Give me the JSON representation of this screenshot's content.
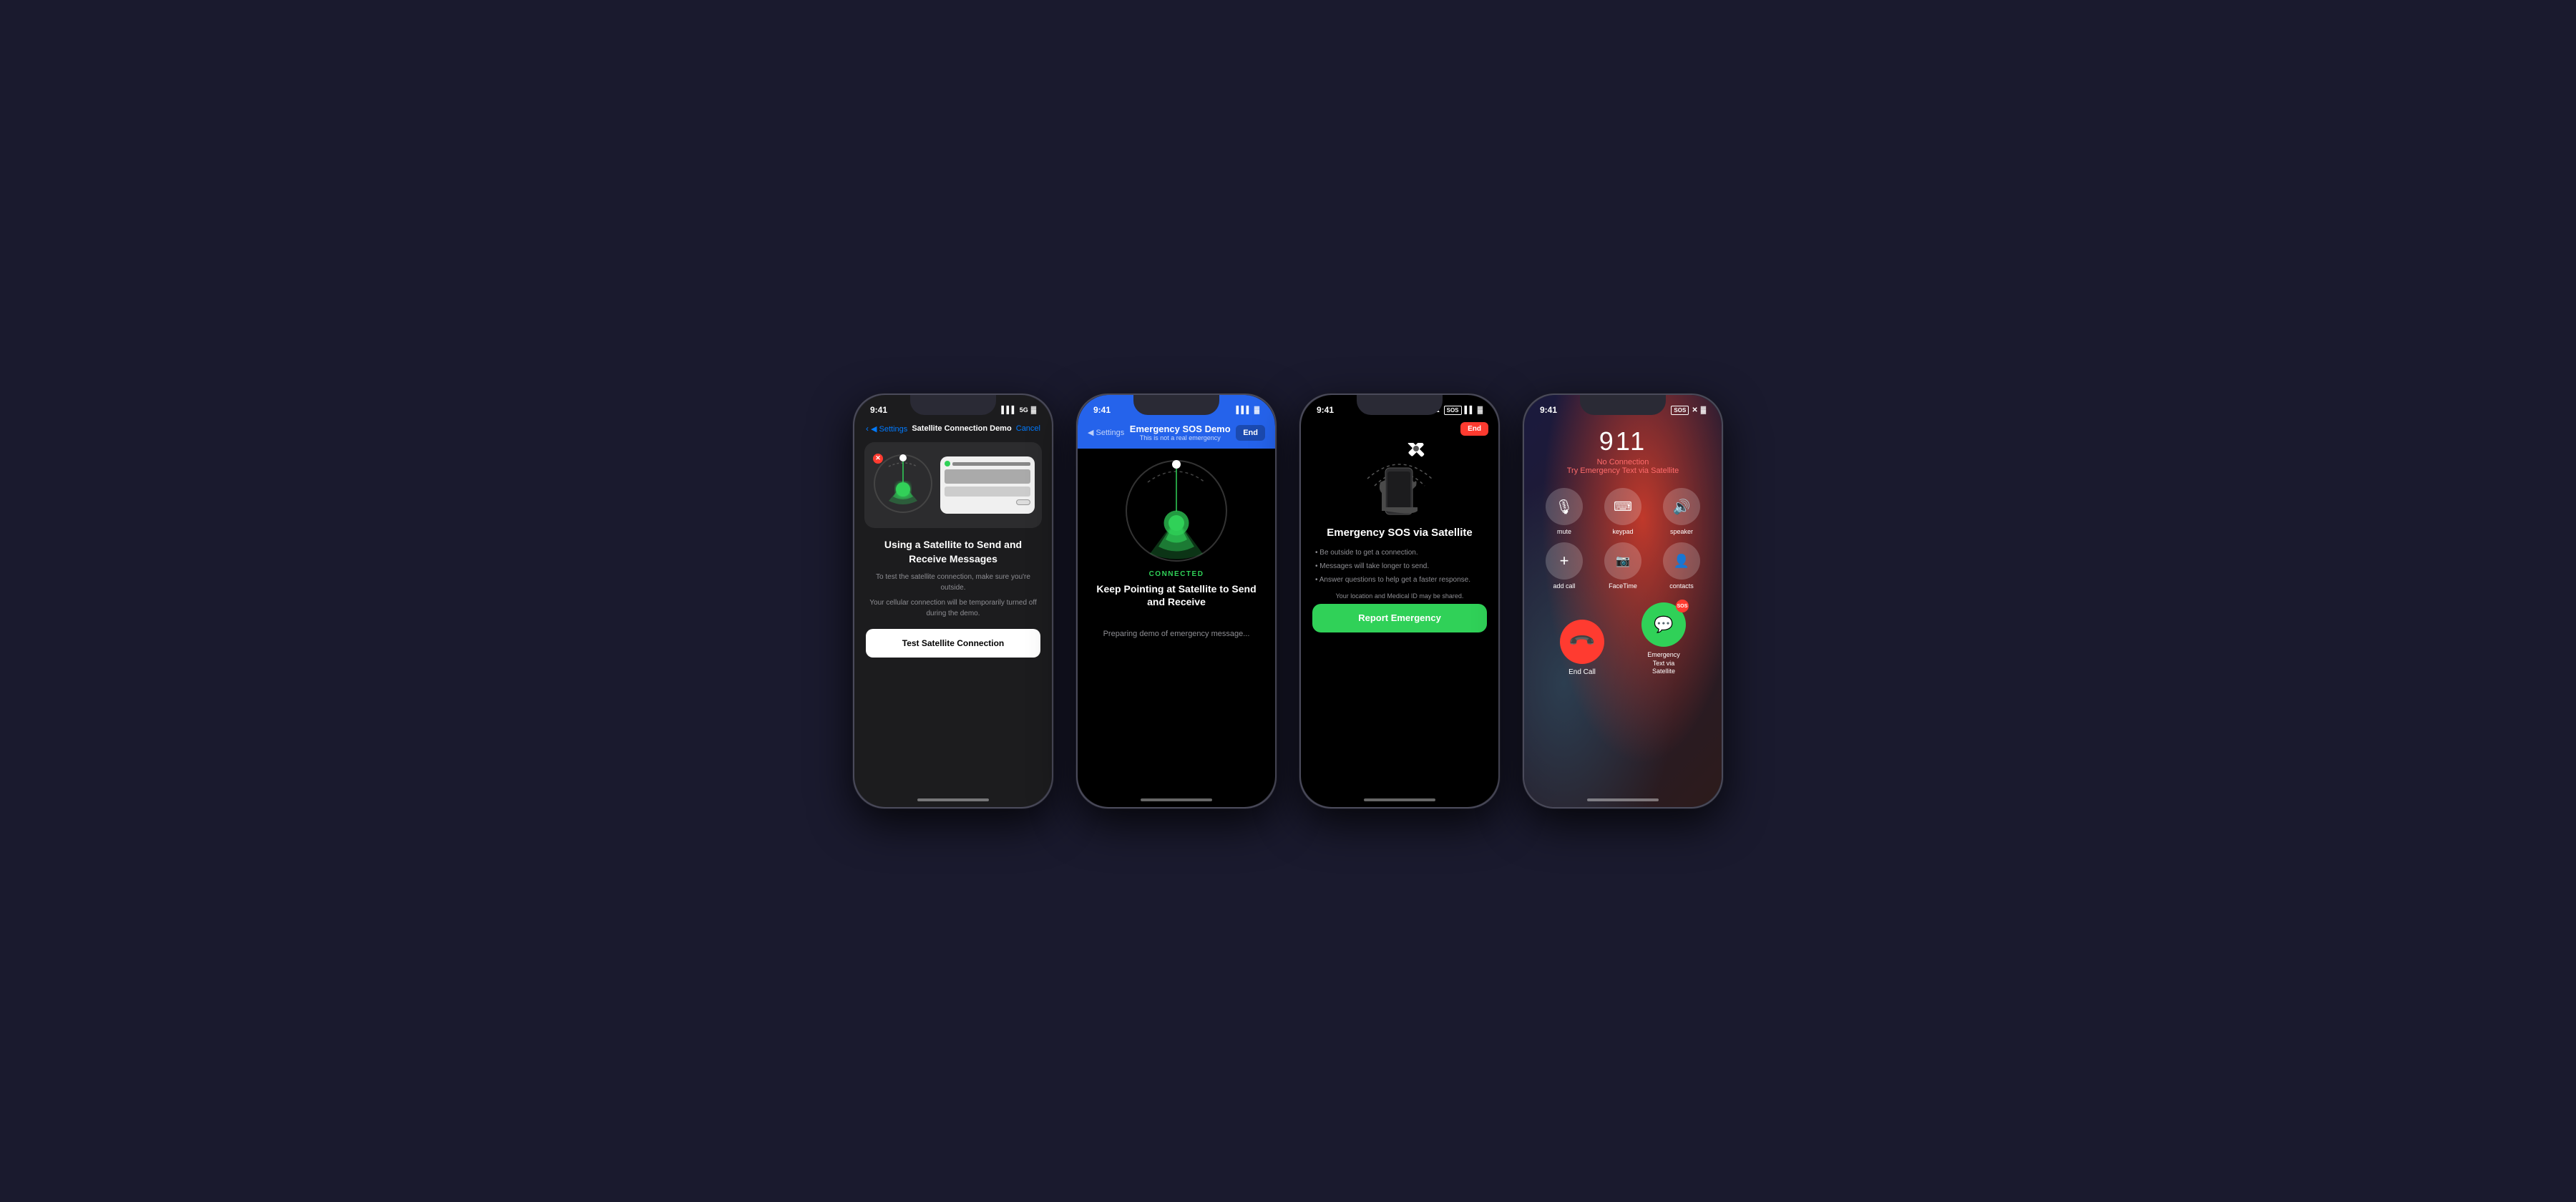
{
  "phone1": {
    "time": "9:41",
    "signal": "●●●● 5G",
    "battery": "▮▮▮",
    "nav_back": "◀ Settings",
    "nav_title": "Satellite Connection Demo",
    "nav_cancel": "Cancel",
    "title": "Using a Satellite to Send and Receive Messages",
    "body1": "To test the satellite connection, make sure you're outside.",
    "body2": "Your cellular connection will be temporarily turned off during the demo.",
    "button": "Test Satellite Connection"
  },
  "phone2": {
    "time": "9:41",
    "nav_back": "◀ Settings",
    "bar_title": "Emergency SOS Demo",
    "bar_sub": "This is not a real emergency",
    "end_btn": "End",
    "connected": "CONNECTED",
    "main_title": "Keep Pointing at Satellite to Send and Receive",
    "sub_text": "Preparing demo of emergency message..."
  },
  "phone3": {
    "time": "9:41",
    "end_btn": "End",
    "title": "Emergency SOS via Satellite",
    "bullet1": "Be outside to get a connection.",
    "bullet2": "Messages will take longer to send.",
    "bullet3": "Answer questions to help get a faster response.",
    "location_note": "Your location and Medical ID may be shared.",
    "report_btn": "Report Emergency"
  },
  "phone4": {
    "time": "9:41",
    "sos_badge": "SOS",
    "call_number": "911",
    "no_connection": "No Connection",
    "try_satellite": "Try Emergency Text via Satellite",
    "mute": "mute",
    "keypad": "keypad",
    "speaker": "speaker",
    "add_call": "add call",
    "facetime": "FaceTime",
    "contacts": "contacts",
    "end_call": "End Call",
    "sos_text_label": "Emergency\nText via\nSatellite"
  },
  "icons": {
    "back_arrow": "‹",
    "signal_bars": "▌▌▌",
    "battery": "▓",
    "close_x": "✕",
    "phone_hang": "📞",
    "message": "💬"
  }
}
